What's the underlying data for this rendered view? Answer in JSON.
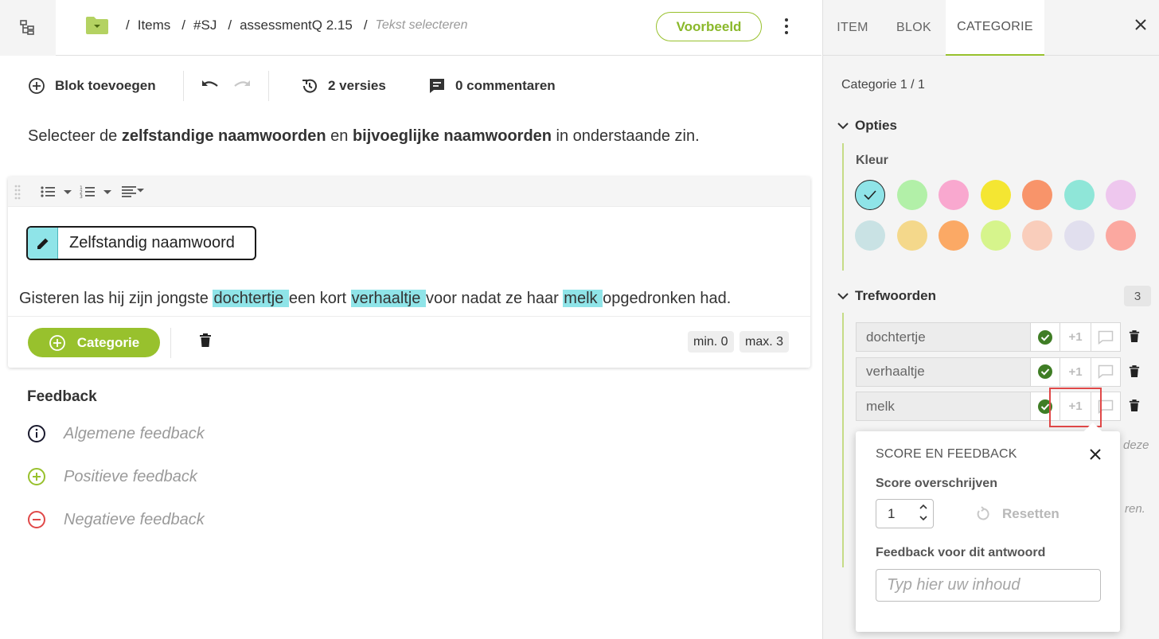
{
  "breadcrumb": {
    "items": [
      "Items",
      "#SJ",
      "assessmentQ 2.15"
    ],
    "current": "Tekst selecteren"
  },
  "header": {
    "preview_label": "Voorbeeld"
  },
  "toolbar": {
    "add_block_label": "Blok toevoegen",
    "versions_label": "2 versies",
    "comments_label": "0 commentaren"
  },
  "instruction": {
    "part1": "Selecteer de ",
    "bold1": "zelfstandige naamwoorden",
    "part2": " en ",
    "bold2": "bijvoeglijke naamwoorden",
    "part3": " in onderstaande zin."
  },
  "editor": {
    "category_label": "Zelfstandig naamwoord",
    "sentence": [
      {
        "text": "Gisteren las hij zijn jongste ",
        "hl": false
      },
      {
        "text": "dochtertje ",
        "hl": true
      },
      {
        "text": "een kort ",
        "hl": false
      },
      {
        "text": "verhaaltje ",
        "hl": true
      },
      {
        "text": "voor nadat ze haar ",
        "hl": false
      },
      {
        "text": "melk ",
        "hl": true
      },
      {
        "text": "opgedronken had.",
        "hl": false
      }
    ],
    "add_category_label": "Categorie",
    "min_label": "min. 0",
    "max_label": "max. 3"
  },
  "feedback": {
    "title": "Feedback",
    "general": "Algemene feedback",
    "positive": "Positieve feedback",
    "negative": "Negatieve feedback"
  },
  "panel": {
    "tabs": [
      "ITEM",
      "BLOK",
      "CATEGORIE"
    ],
    "active_tab": "CATEGORIE",
    "category_count": "Categorie 1 / 1",
    "options_label": "Opties",
    "color_label": "Kleur",
    "colors": [
      "#8fe4e8",
      "#b2f0a8",
      "#f9a8cf",
      "#f4e632",
      "#f8946a",
      "#8fe6d8",
      "#eec7ee",
      "#c9e2e4",
      "#f4d88b",
      "#fba965",
      "#d6f48c",
      "#f9cdbb",
      "#e1dfee",
      "#fba8a0"
    ],
    "selected_color": "#8fe4e8",
    "keywords_label": "Trefwoorden",
    "keywords_count": "3",
    "keywords": [
      "dochtertje",
      "verhaaltje",
      "melk"
    ],
    "score_default": "+1",
    "peek_text_1": "deze",
    "peek_text_2": "ren."
  },
  "popup": {
    "title": "SCORE EN FEEDBACK",
    "score_label": "Score overschrijven",
    "score_value": "1",
    "reset_label": "Resetten",
    "feedback_label": "Feedback voor dit antwoord",
    "feedback_placeholder": "Typ hier uw inhoud"
  },
  "colors": {
    "accent": "#98c12d",
    "highlight": "#8fe4e8",
    "danger": "#e04848"
  }
}
